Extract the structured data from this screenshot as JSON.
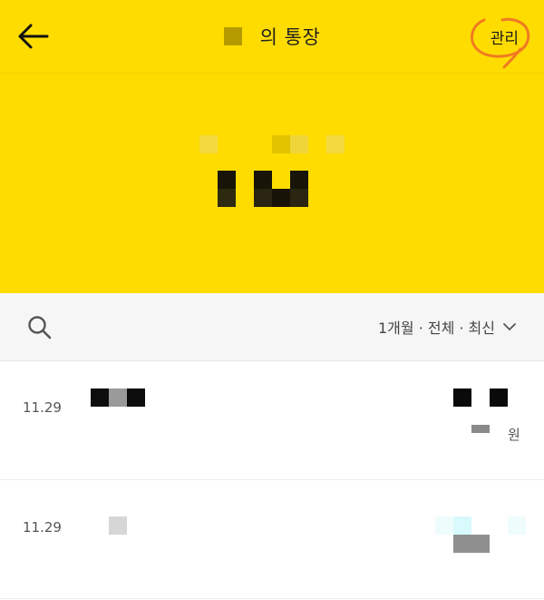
{
  "header": {
    "title": "의 통장",
    "manage_label": "관리",
    "back_icon": "arrow-left-icon"
  },
  "colors": {
    "brand_yellow": "#ffdc00",
    "annotation_orange": "#f07a23"
  },
  "filter": {
    "search_icon": "search-icon",
    "label": "1개월 · 전체 · 최신",
    "dropdown_icon": "chevron-down-icon"
  },
  "transactions": [
    {
      "date": "11.29",
      "amount_unit": "원"
    },
    {
      "date": "11.29"
    }
  ]
}
